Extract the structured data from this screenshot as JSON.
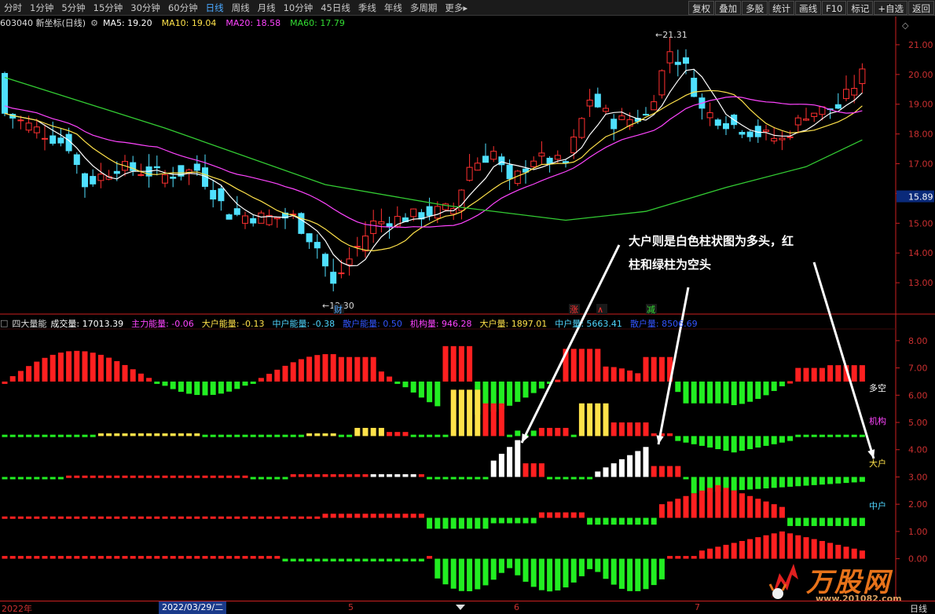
{
  "toolbar": {
    "periods": [
      {
        "label": "分时",
        "active": false
      },
      {
        "label": "1分钟",
        "active": false
      },
      {
        "label": "5分钟",
        "active": false
      },
      {
        "label": "15分钟",
        "active": false
      },
      {
        "label": "30分钟",
        "active": false
      },
      {
        "label": "60分钟",
        "active": false
      },
      {
        "label": "日线",
        "active": true
      },
      {
        "label": "周线",
        "active": false
      },
      {
        "label": "月线",
        "active": false
      },
      {
        "label": "10分钟",
        "active": false
      },
      {
        "label": "45日线",
        "active": false
      },
      {
        "label": "季线",
        "active": false
      },
      {
        "label": "年线",
        "active": false
      },
      {
        "label": "多周期",
        "active": false
      },
      {
        "label": "更多▸",
        "active": false
      }
    ],
    "tools": [
      "复权",
      "叠加",
      "多股",
      "统计",
      "画线",
      "F10",
      "标记",
      "+自选",
      "返回"
    ]
  },
  "main_chart": {
    "stock_label": "603040 新坐标(日线)",
    "ma_items": [
      {
        "label": "MA5: 19.20",
        "color": "#ffffff"
      },
      {
        "label": "MA10: 19.04",
        "color": "#ffe24a"
      },
      {
        "label": "MA20: 18.58",
        "color": "#ff44ff"
      },
      {
        "label": "MA60: 17.79",
        "color": "#33dd33"
      }
    ],
    "price_ticks": [
      "21.00",
      "20.00",
      "19.00",
      "18.00",
      "17.00",
      "16.00",
      "15.00",
      "14.00",
      "13.00"
    ],
    "current_price": "15.89",
    "high_label": "21.31",
    "low_label": "12.30",
    "markers": [
      "财",
      "涨",
      "∧",
      "减"
    ]
  },
  "indicator": {
    "name": "四大量能",
    "items": [
      {
        "label": "成交量: 17013.39",
        "color": "#ffffff"
      },
      {
        "label": "主力能量: -0.06",
        "color": "#ff44ff"
      },
      {
        "label": "大户能量: -0.13",
        "color": "#ffe24a"
      },
      {
        "label": "中户能量: -0.38",
        "color": "#4fd6ff"
      },
      {
        "label": "散户能量: 0.50",
        "color": "#3355ff"
      },
      {
        "label": "机构量: 946.28",
        "color": "#ff44ff"
      },
      {
        "label": "大户量: 1897.01",
        "color": "#ffe24a"
      },
      {
        "label": "中户量: 5663.41",
        "color": "#4fd6ff"
      },
      {
        "label": "散户量: 8506.69",
        "color": "#3355ff"
      }
    ],
    "y_ticks": [
      "8.00",
      "7.00",
      "6.00",
      "5.00",
      "4.00",
      "3.00",
      "2.00",
      "1.00",
      "0.00"
    ],
    "row_labels": [
      {
        "text": "多空",
        "color": "#ffffff"
      },
      {
        "text": "机构",
        "color": "#ff44ff"
      },
      {
        "text": "大户",
        "color": "#ffe24a"
      },
      {
        "text": "中户",
        "color": "#4fd6ff"
      }
    ]
  },
  "annotation": {
    "line1": "大户则是白色柱状图为多头，红",
    "line2": "柱和绿柱为空头"
  },
  "timebar": {
    "start": "2022年",
    "cursor_date": "2022/03/29/二",
    "months": [
      "5",
      "6",
      "7"
    ],
    "right_label": "日线"
  },
  "watermark": {
    "title": "万股网",
    "url": "www.201082.com"
  }
}
